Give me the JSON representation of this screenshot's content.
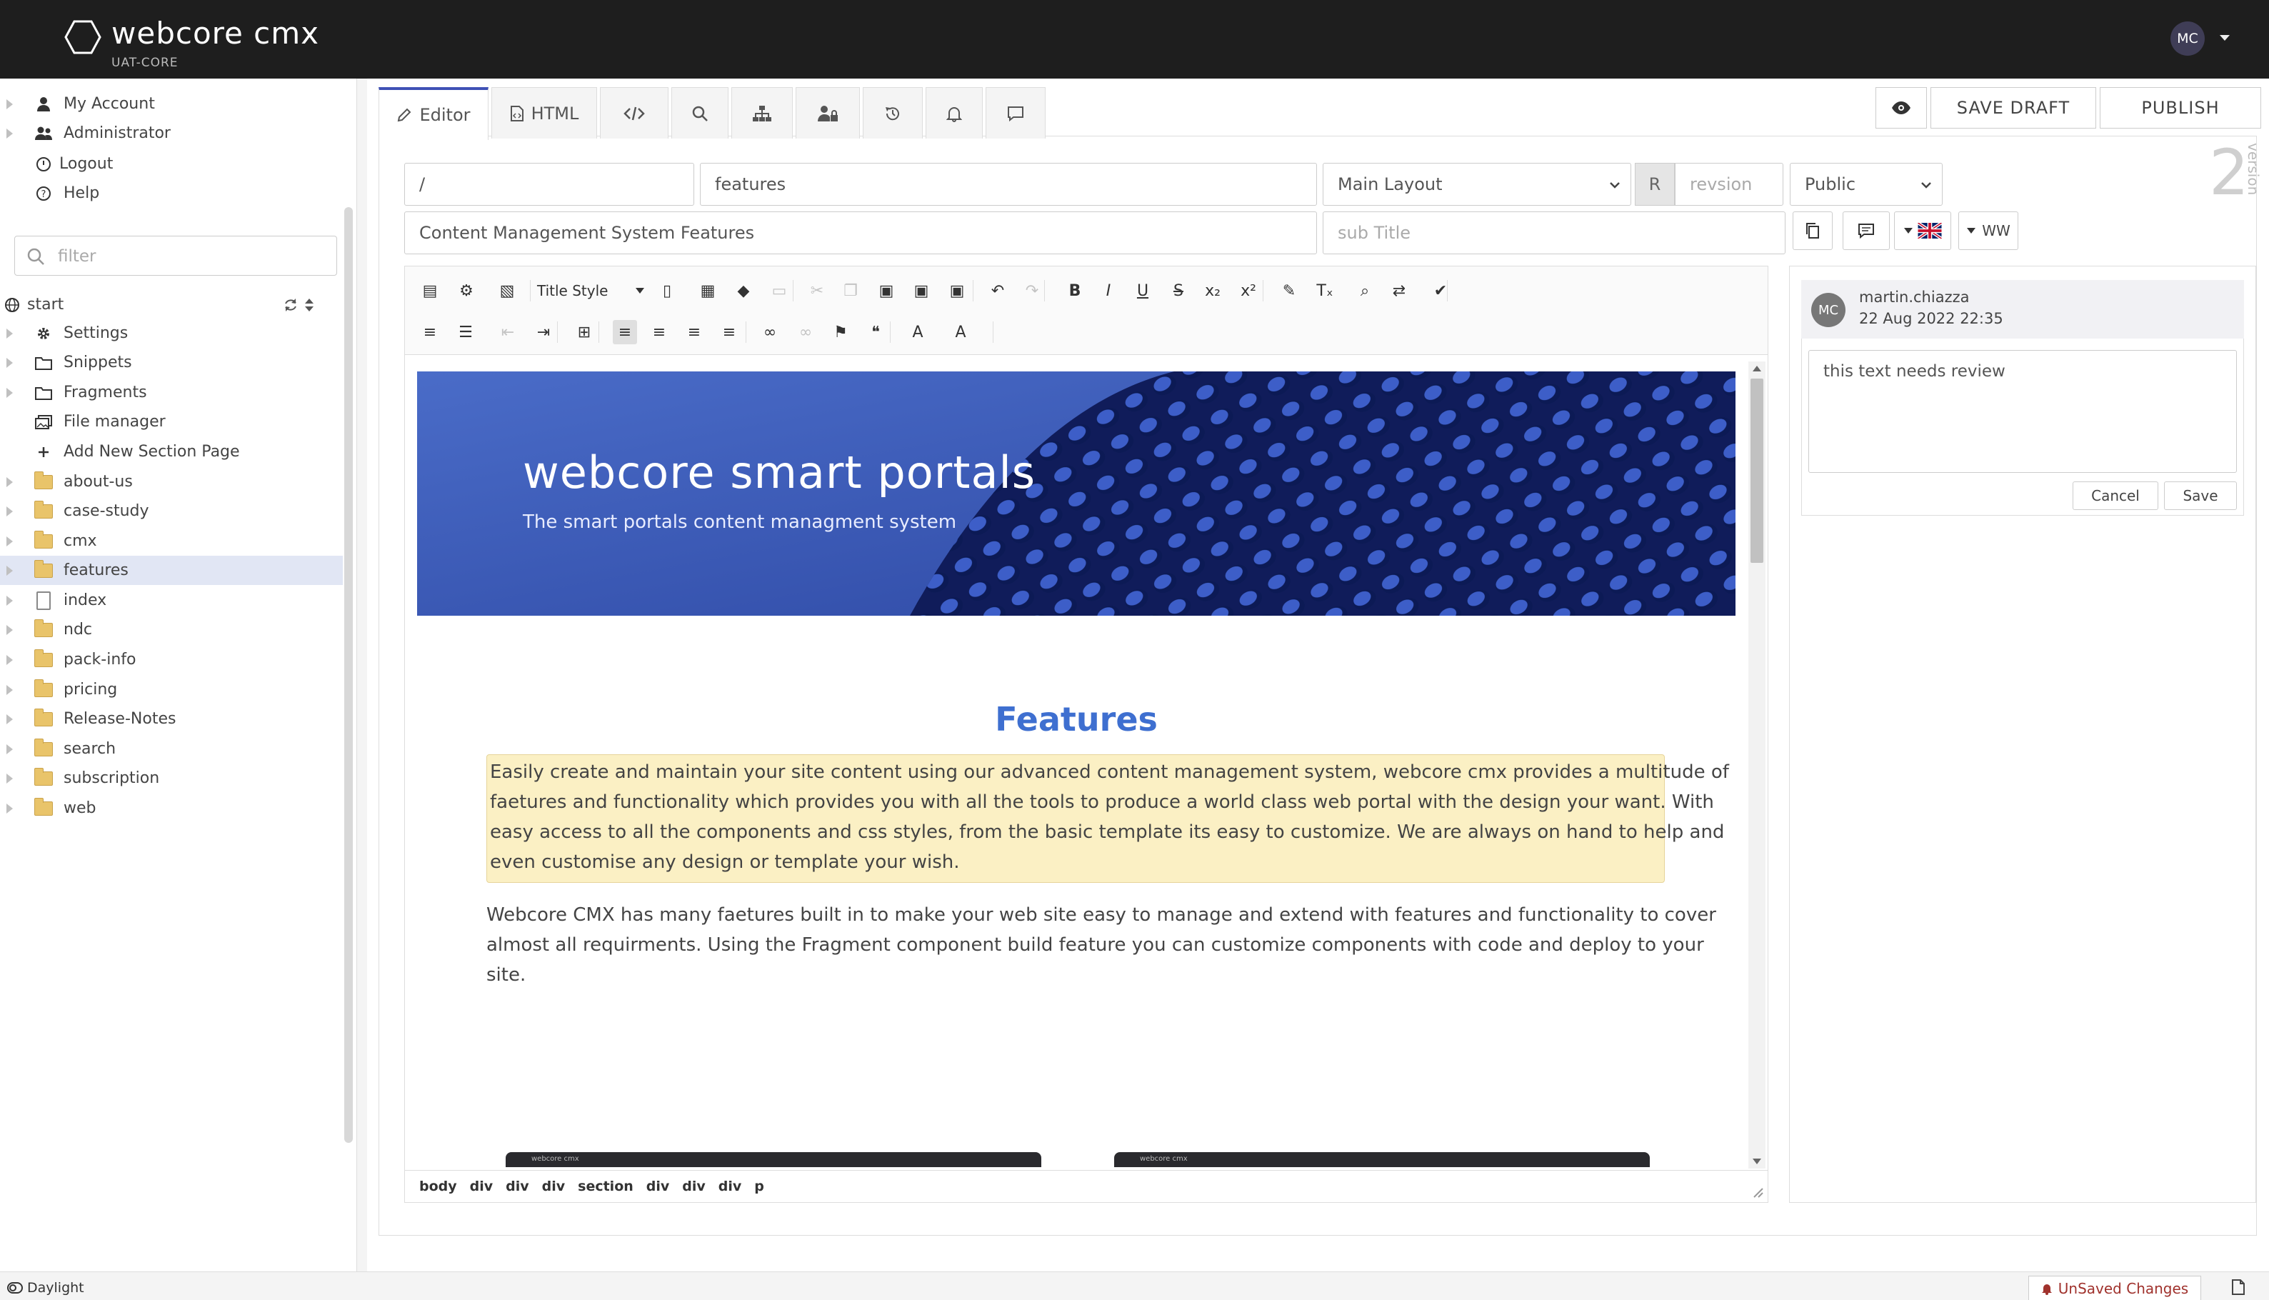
{
  "app": {
    "name": "webcore cmx",
    "subtitle": "UAT-CORE",
    "user_initials": "MC"
  },
  "sidebar": {
    "menu": [
      {
        "label": "My Account",
        "icon": "user-icon"
      },
      {
        "label": "Administrator",
        "icon": "users-icon"
      },
      {
        "label": "Logout",
        "icon": "power-icon"
      },
      {
        "label": "Help",
        "icon": "question-icon"
      }
    ],
    "filter_placeholder": "filter",
    "root": "start",
    "tree": [
      {
        "label": "Settings",
        "icon": "gear-icon"
      },
      {
        "label": "Snippets",
        "icon": "folder-outline-icon"
      },
      {
        "label": "Fragments",
        "icon": "folder-outline-icon"
      },
      {
        "label": "File manager",
        "icon": "images-icon"
      },
      {
        "label": "Add New Section Page",
        "icon": "plus-icon"
      },
      {
        "label": "about-us",
        "icon": "folder-icon"
      },
      {
        "label": "case-study",
        "icon": "folder-icon"
      },
      {
        "label": "cmx",
        "icon": "folder-icon"
      },
      {
        "label": "features",
        "icon": "folder-icon",
        "selected": true
      },
      {
        "label": "index",
        "icon": "page-icon"
      },
      {
        "label": "ndc",
        "icon": "folder-icon"
      },
      {
        "label": "pack-info",
        "icon": "folder-icon"
      },
      {
        "label": "pricing",
        "icon": "folder-icon"
      },
      {
        "label": "Release-Notes",
        "icon": "folder-icon"
      },
      {
        "label": "search",
        "icon": "folder-icon"
      },
      {
        "label": "subscription",
        "icon": "folder-icon"
      },
      {
        "label": "web",
        "icon": "folder-icon"
      }
    ]
  },
  "tabs": {
    "editor": "Editor",
    "html": "HTML"
  },
  "actions": {
    "save_draft": "SAVE DRAFT",
    "publish": "PUBLISH"
  },
  "form": {
    "path": "/",
    "name": "features",
    "layout": "Main Layout",
    "r_label": "R",
    "revision_placeholder": "revsion",
    "visibility": "Public",
    "title": "Content Management System Features",
    "subtitle_placeholder": "sub Title",
    "lang_code": "WW"
  },
  "version": {
    "number": "2",
    "label": "version"
  },
  "toolbar": {
    "title_style": "Title Style"
  },
  "content": {
    "hero_title": "webcore smart portals",
    "hero_subtitle": "The smart portals content managment system",
    "heading": "Features",
    "highlight_lines": [
      "Easily create and maintain your site content using our advanced content management system,  webcore cmx provides a multitude of",
      "faetures and functionality which provides you with all the tools to produce a world class web portal with the design your want.   With",
      "easy access to all the components and css styles, from the basic template its easy to customize.  We are always on hand to help and",
      "even customise any design or template your wish."
    ],
    "para_lines": [
      "Webcore CMX has many faetures built in to make your web site easy to manage and extend with features and functionality to cover",
      "almost all requirments.  Using the Fragment component build feature you can customize components with code and deploy to your",
      "site."
    ],
    "thumb_brand": "webcore cmx"
  },
  "pathbar": [
    "body",
    "div",
    "div",
    "div",
    "section",
    "div",
    "div",
    "div",
    "p"
  ],
  "comment": {
    "initials": "MC",
    "user": "martin.chiazza",
    "date": "22 Aug 2022 22:35",
    "text": "this text needs review",
    "cancel": "Cancel",
    "save": "Save"
  },
  "status": {
    "theme": "Daylight",
    "unsaved": "UnSaved Changes"
  },
  "colors": {
    "accent": "#3f51b5",
    "heading": "#3e6fd0",
    "highlight": "#fbf0c4",
    "topbar": "#1e1e1e"
  }
}
